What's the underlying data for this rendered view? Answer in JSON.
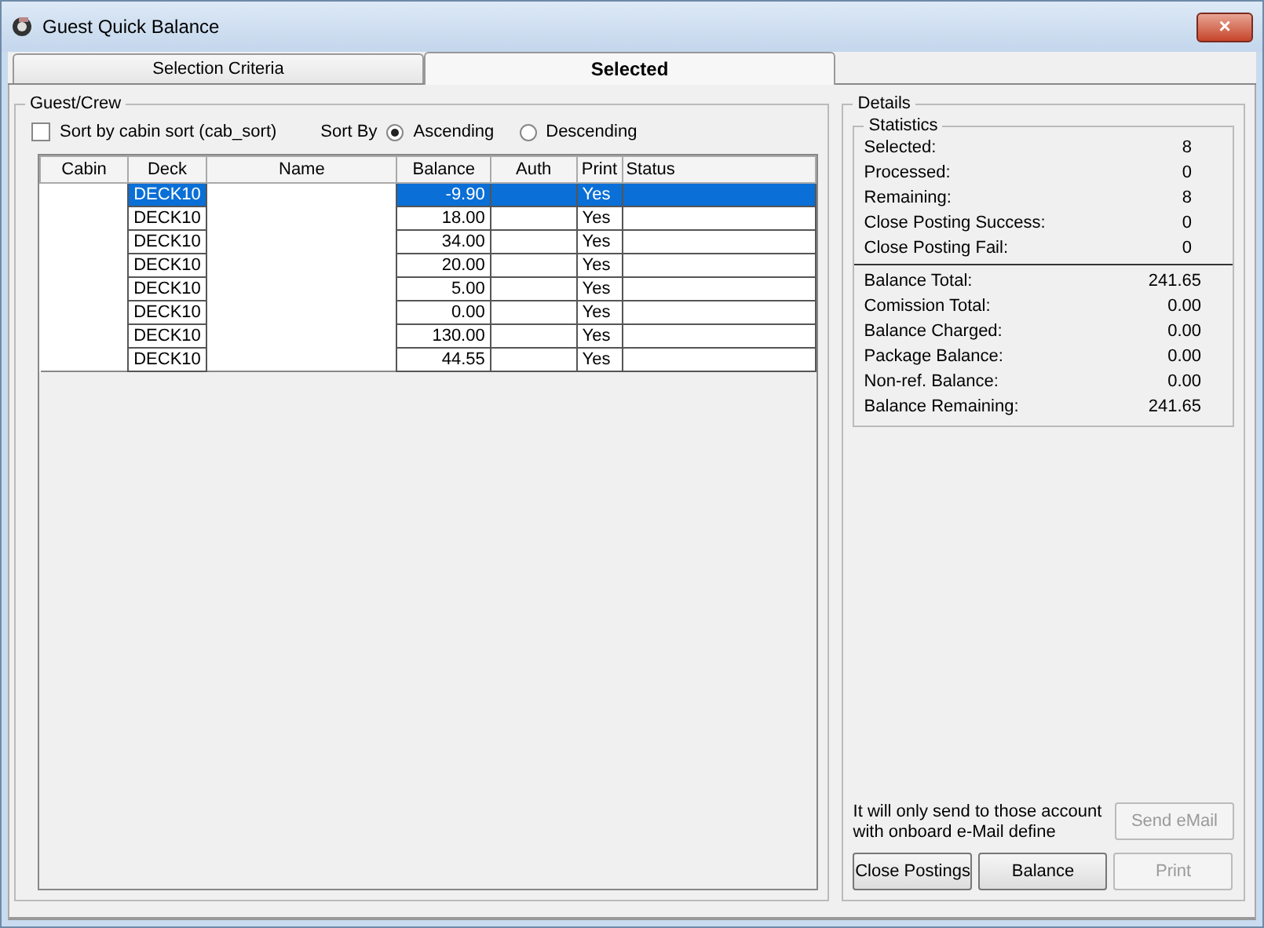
{
  "window": {
    "title": "Guest Quick Balance",
    "close": "×"
  },
  "tabs": [
    {
      "label": "Selection Criteria",
      "selected": false
    },
    {
      "label": "Selected",
      "selected": true
    }
  ],
  "guest_crew": {
    "title": "Guest/Crew",
    "sort_by_cabin": {
      "label": "Sort by cabin sort (cab_sort)",
      "checked": false
    },
    "sort_by": {
      "label": "Sort By",
      "options": [
        {
          "label": "Ascending",
          "selected": true
        },
        {
          "label": "Descending",
          "selected": false
        }
      ]
    },
    "table": {
      "columns": [
        "Cabin",
        "Deck",
        "Name",
        "Balance",
        "Auth",
        "Print",
        "Status"
      ],
      "rows": [
        {
          "deck": "DECK10",
          "balance": "-9.90",
          "print": "Yes",
          "selected": true
        },
        {
          "deck": "DECK10",
          "balance": "18.00",
          "print": "Yes",
          "selected": false
        },
        {
          "deck": "DECK10",
          "balance": "34.00",
          "print": "Yes",
          "selected": false
        },
        {
          "deck": "DECK10",
          "balance": "20.00",
          "print": "Yes",
          "selected": false
        },
        {
          "deck": "DECK10",
          "balance": "5.00",
          "print": "Yes",
          "selected": false
        },
        {
          "deck": "DECK10",
          "balance": "0.00",
          "print": "Yes",
          "selected": false
        },
        {
          "deck": "DECK10",
          "balance": "130.00",
          "print": "Yes",
          "selected": false
        },
        {
          "deck": "DECK10",
          "balance": "44.55",
          "print": "Yes",
          "selected": false
        }
      ]
    }
  },
  "details": {
    "title": "Details",
    "statistics_title": "Statistics",
    "statistics": [
      {
        "label": "Selected:",
        "value": "8"
      },
      {
        "label": "Processed:",
        "value": "0"
      },
      {
        "label": "Remaining:",
        "value": "8"
      },
      {
        "label": "Close Posting Success:",
        "value": "0"
      },
      {
        "label": "Close Posting Fail:",
        "value": "0"
      }
    ],
    "totals": [
      {
        "label": "Balance Total:",
        "value": "241.65"
      },
      {
        "label": "Comission Total:",
        "value": "0.00"
      },
      {
        "label": "Balance Charged:",
        "value": "0.00"
      },
      {
        "label": "Package Balance:",
        "value": "0.00"
      },
      {
        "label": "Non-ref. Balance:",
        "value": "0.00"
      },
      {
        "label": "Balance Remaining:",
        "value": "241.65"
      }
    ],
    "email_note": "It will only send to those account with onboard e-Mail define",
    "send_email": {
      "label": "Send eMail",
      "disabled": true
    },
    "buttons": [
      {
        "label": "Close Postings",
        "disabled": false
      },
      {
        "label": "Balance",
        "disabled": false
      },
      {
        "label": "Print",
        "disabled": true
      }
    ]
  }
}
